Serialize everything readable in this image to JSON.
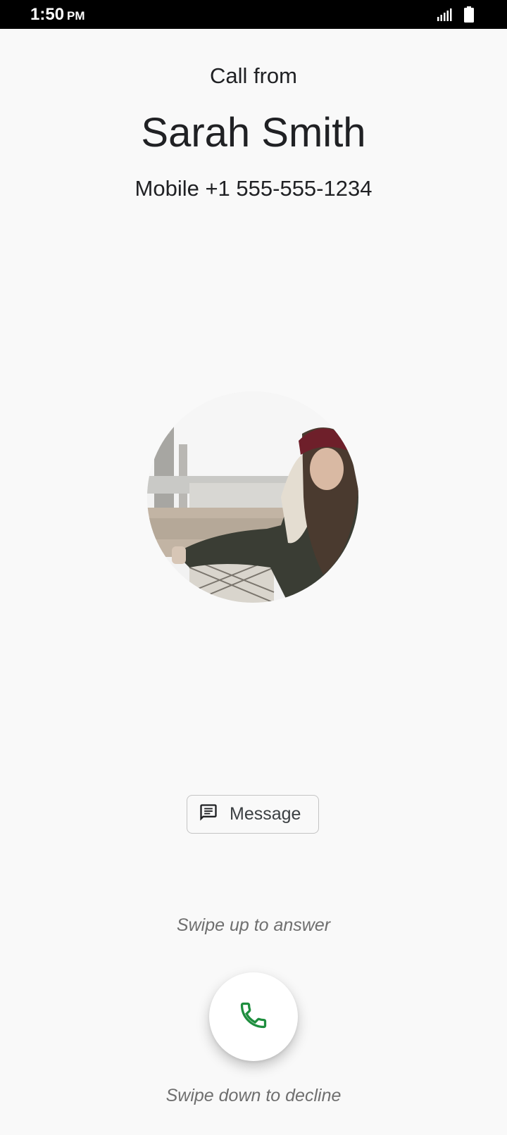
{
  "status_bar": {
    "time": "1:50",
    "ampm": "PM",
    "icons": [
      "signal-icon",
      "battery-icon"
    ]
  },
  "call": {
    "header": "Call from",
    "caller_name": "Sarah Smith",
    "caller_number": "Mobile +1 555-555-1234"
  },
  "actions": {
    "message_label": "Message",
    "swipe_up_hint": "Swipe up to answer",
    "swipe_down_hint": "Swipe down to decline",
    "answer_icon": "phone-icon",
    "answer_color": "#1e8e3e"
  }
}
